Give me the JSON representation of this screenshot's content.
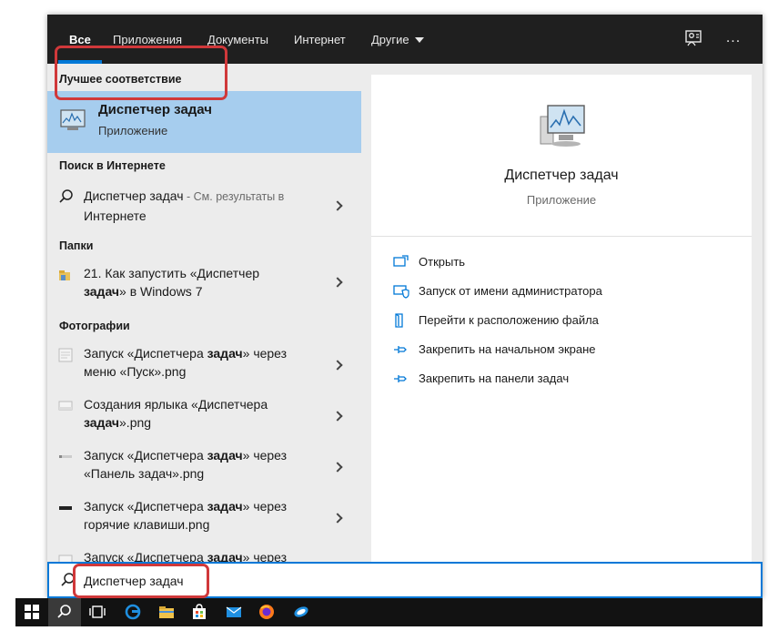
{
  "nav": {
    "tabs": [
      "Все",
      "Приложения",
      "Документы",
      "Интернет",
      "Другие"
    ],
    "active": "Все",
    "more_menu": "..."
  },
  "left": {
    "best_match": {
      "section": "Лучшее соответствие",
      "title": "Диспетчер задач",
      "subtitle": "Приложение",
      "highlight_color": "#d0383a"
    },
    "web": {
      "section": "Поиск в Интернете",
      "item": {
        "query": "Диспетчер задач",
        "suffix": " - См. результаты в",
        "suffix2": "Интернете"
      }
    },
    "folders": {
      "section": "Папки",
      "item": {
        "line1": "21. Как запустить «Диспетчер",
        "line2_bold": "задач",
        "line2_rest": "» в Windows 7"
      }
    },
    "photos": {
      "section": "Фотографии",
      "items": [
        {
          "a": "Запуск «Диспетчера ",
          "b": "задач",
          "c": "» через",
          "d": "меню «Пуск».png",
          "d_bold": ""
        },
        {
          "a": "Создания ярлыка «Диспетчера",
          "b": "",
          "c": "",
          "d_bold": "задач",
          "d": "».png"
        },
        {
          "a": "Запуск «Диспетчера ",
          "b": "задач",
          "c": "» через",
          "d": "«Панель задач».png",
          "d_bold": ""
        },
        {
          "a": "Запуск «Диспетчера ",
          "b": "задач",
          "c": "» через",
          "d": "горячие клавиши.png",
          "d_bold": ""
        },
        {
          "a": "Запуск «Диспетчера ",
          "b": "задач",
          "c": "» через",
          "d": "",
          "d_bold": ""
        }
      ]
    }
  },
  "preview": {
    "title": "Диспетчер задач",
    "subtitle": "Приложение",
    "actions": [
      {
        "icon": "open-icon",
        "label": "Открыть"
      },
      {
        "icon": "shield-run-as-admin-icon",
        "label": "Запуск от имени администратора"
      },
      {
        "icon": "file-location-icon",
        "label": "Перейти к расположению файла"
      },
      {
        "icon": "pin-start-icon",
        "label": "Закрепить на начальном экране"
      },
      {
        "icon": "pin-taskbar-icon",
        "label": "Закрепить на панели задач"
      }
    ]
  },
  "search": {
    "value": "Диспетчер задач",
    "accent": "#0078d7"
  },
  "taskbar": {
    "icons": [
      "windows-start-icon",
      "search-icon",
      "task-view-icon",
      "edge-icon",
      "file-explorer-icon",
      "store-icon",
      "mail-icon",
      "firefox-icon",
      "app-icon"
    ]
  }
}
